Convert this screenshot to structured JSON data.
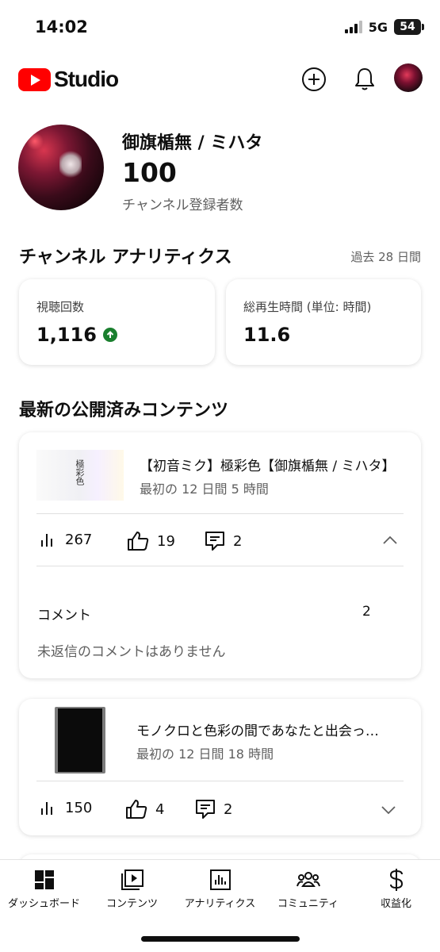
{
  "status_bar": {
    "time": "14:02",
    "network": "5G",
    "battery": "54"
  },
  "app": {
    "logo_text": "Studio",
    "brand_color": "#ff0000"
  },
  "channel": {
    "name": "御旗楯無 / ミハタ",
    "subscriber_count": "100",
    "subscriber_label": "チャンネル登録者数"
  },
  "analytics": {
    "title": "チャンネル アナリティクス",
    "period": "過去 28 日間",
    "views": {
      "label": "視聴回数",
      "value": "1,116",
      "trend": "up"
    },
    "watch_time": {
      "label": "総再生時間 (単位: 時間)",
      "value": "11.6"
    }
  },
  "latest_content": {
    "title": "最新の公開済みコンテンツ",
    "items": [
      {
        "title": "【初音ミク】極彩色【御旗楯無 / ミハタ】",
        "subtitle": "最初の 12 日間 5 時間",
        "thumb_text": "極彩色",
        "views": "267",
        "likes": "19",
        "comments": "2",
        "expanded": true,
        "comments_section": {
          "label": "コメント",
          "count": "2",
          "empty_text": "未返信のコメントはありません"
        }
      },
      {
        "title": "モノクロと色彩の間であなたと出会っ…",
        "subtitle": "最初の 12 日間 18 時間",
        "views": "150",
        "likes": "4",
        "comments": "2",
        "expanded": false
      }
    ]
  },
  "nav": {
    "items": [
      {
        "label": "ダッシュボード",
        "icon": "dashboard-icon",
        "active": true
      },
      {
        "label": "コンテンツ",
        "icon": "content-icon"
      },
      {
        "label": "アナリティクス",
        "icon": "analytics-icon"
      },
      {
        "label": "コミュニティ",
        "icon": "community-icon"
      },
      {
        "label": "収益化",
        "icon": "dollar-icon"
      }
    ]
  }
}
